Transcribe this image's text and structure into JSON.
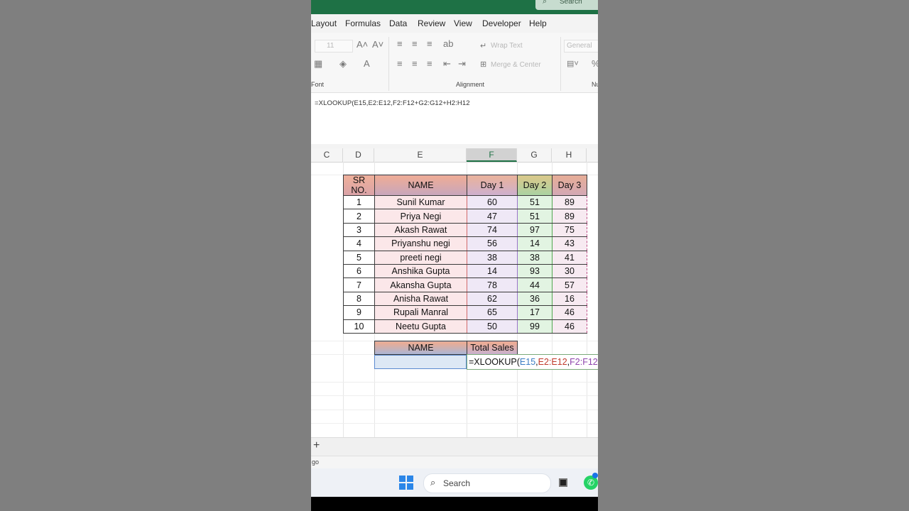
{
  "titlebar": {
    "search_label": "Search"
  },
  "menu_tabs": [
    "Layout",
    "Formulas",
    "Data",
    "Review",
    "View",
    "Developer",
    "Help"
  ],
  "ribbon": {
    "font_size": "11",
    "font_group_label": "Font",
    "alignment_group_label": "Alignment",
    "wrap_text": "Wrap Text",
    "merge_center": "Merge & Center",
    "number_format": "General",
    "number_group_label": "Nu"
  },
  "formula_bar": {
    "formula": "=XLOOKUP(E15,E2:E12,F2:F12+G2:G12+H2:H12"
  },
  "columns": [
    "C",
    "D",
    "E",
    "F",
    "G",
    "H"
  ],
  "active_column": "F",
  "table": {
    "headers": [
      "SR NO.",
      "NAME",
      "Day 1",
      "Day 2",
      "Day 3"
    ],
    "rows": [
      [
        "1",
        "Sunil  Kumar",
        "60",
        "51",
        "89"
      ],
      [
        "2",
        "Priya Negi",
        "47",
        "51",
        "89"
      ],
      [
        "3",
        "Akash Rawat",
        "74",
        "97",
        "75"
      ],
      [
        "4",
        "Priyanshu negi",
        "56",
        "14",
        "43"
      ],
      [
        "5",
        "preeti negi",
        "38",
        "38",
        "41"
      ],
      [
        "6",
        "Anshika Gupta",
        "14",
        "93",
        "30"
      ],
      [
        "7",
        "Akansha Gupta",
        "78",
        "44",
        "57"
      ],
      [
        "8",
        "Anisha Rawat",
        "62",
        "36",
        "16"
      ],
      [
        "9",
        "Rupali Manral",
        "65",
        "17",
        "46"
      ],
      [
        "10",
        "Neetu Gupta",
        "50",
        "99",
        "46"
      ]
    ]
  },
  "lookup": {
    "headers": [
      "NAME",
      "Total Sales"
    ],
    "name_value": "",
    "formula_parts": [
      {
        "text": "=XLOOKUP(",
        "color": "#111111"
      },
      {
        "text": "E15",
        "color": "#3b7dc4"
      },
      {
        "text": ",",
        "color": "#111111"
      },
      {
        "text": "E2:E12",
        "color": "#c0392b"
      },
      {
        "text": ",",
        "color": "#111111"
      },
      {
        "text": "F2:F12",
        "color": "#8e44ad"
      },
      {
        "text": "+",
        "color": "#111111"
      }
    ]
  },
  "sheet": {
    "add_label": "+"
  },
  "status": {
    "text": "go"
  },
  "taskbar": {
    "search_label": "Search"
  },
  "colors": {
    "excel_green": "#1e7145",
    "windows_blue": "#2b86e8"
  }
}
